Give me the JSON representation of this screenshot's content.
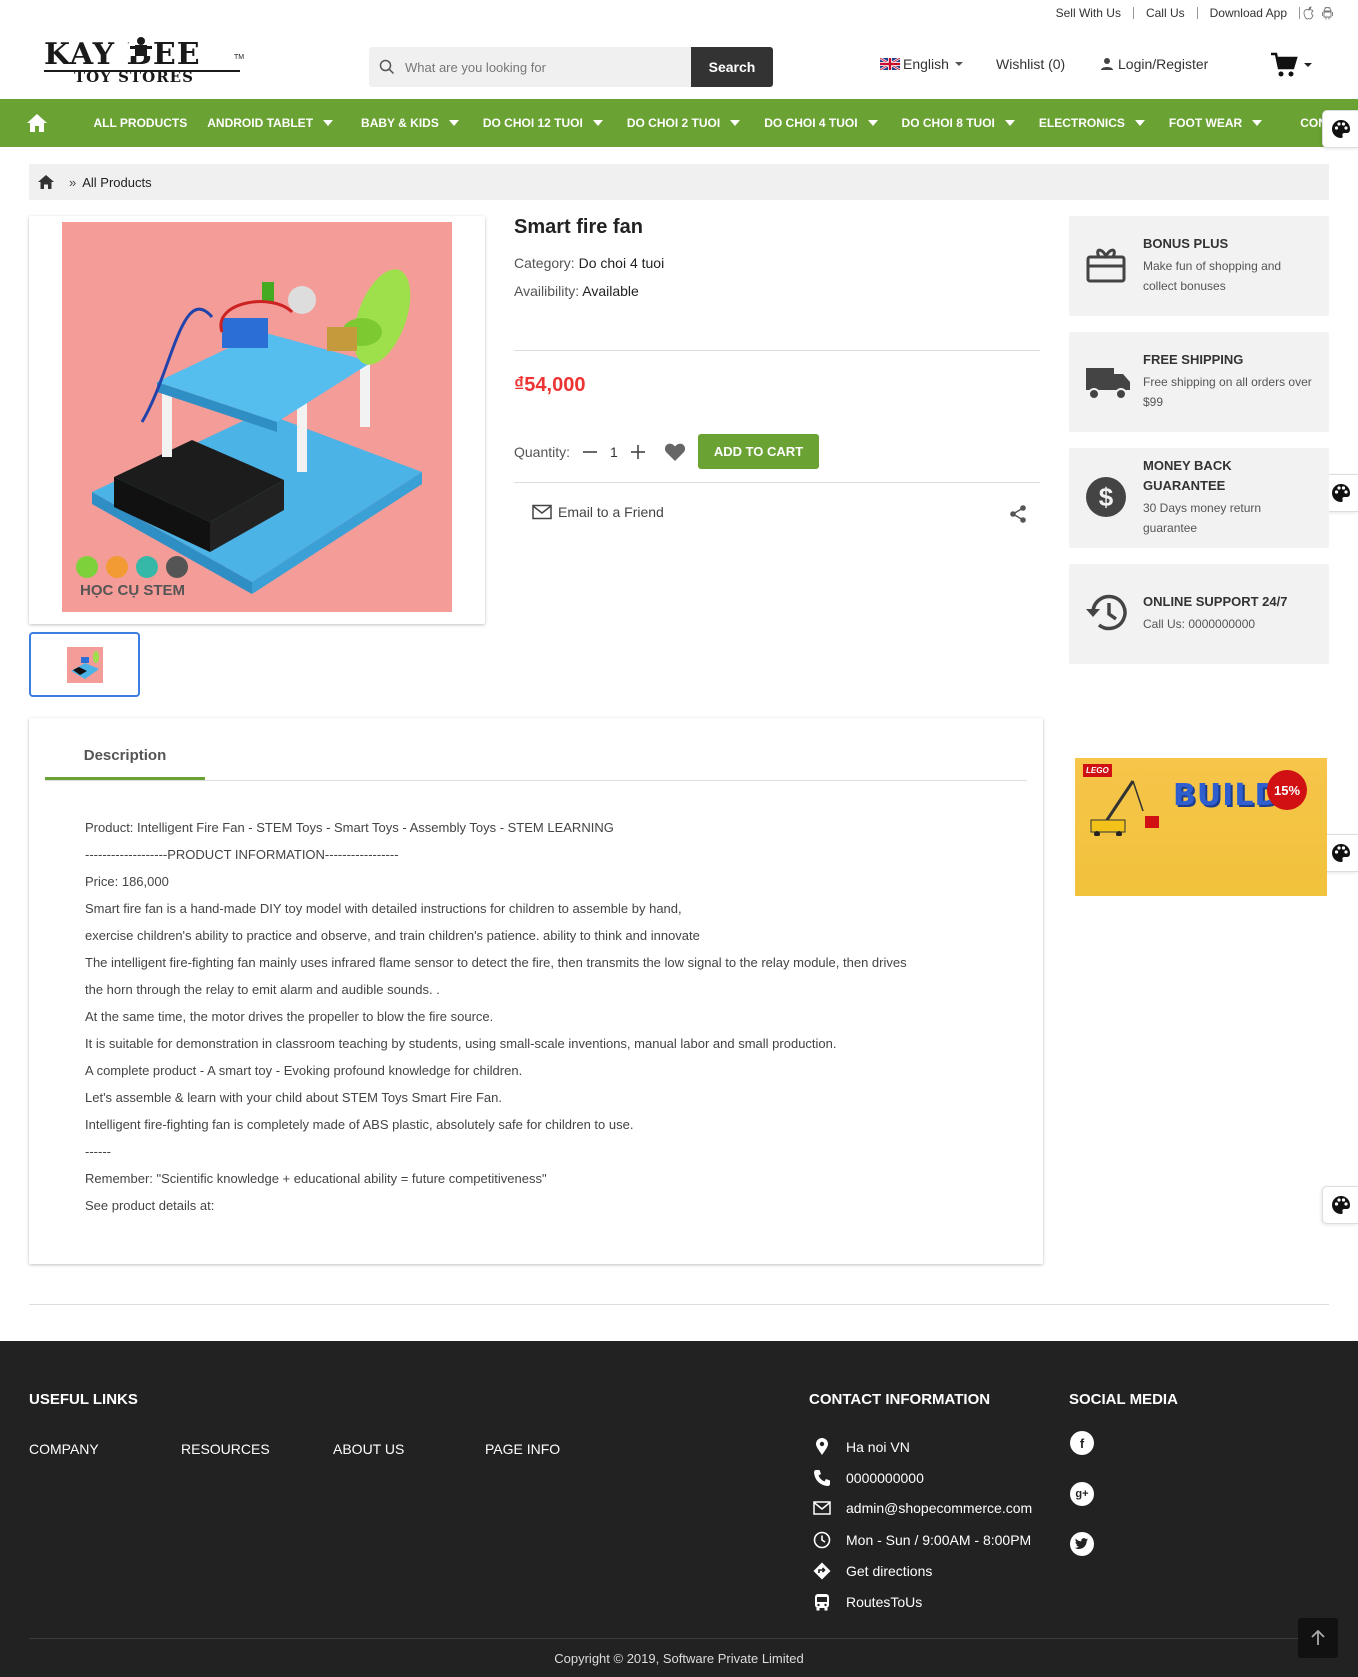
{
  "topbar": {
    "sell": "Sell With Us",
    "call": "Call Us",
    "download": "Download App"
  },
  "logo": {
    "line1": "KAY BEE",
    "line2": "TOY STORES",
    "tm": "TM"
  },
  "search": {
    "placeholder": "What are you looking for",
    "button": "Search"
  },
  "header": {
    "language": "English",
    "wishlist": "Wishlist (0)",
    "login": "Login/Register"
  },
  "nav": {
    "items": [
      {
        "label": "ALL PRODUCTS"
      },
      {
        "label": "ANDROID TABLET"
      },
      {
        "label": "BABY & KIDS"
      },
      {
        "label": "DO CHOI 12 TUOI"
      },
      {
        "label": "DO CHOI 2 TUOI"
      },
      {
        "label": "DO CHOI 4 TUOI"
      },
      {
        "label": "DO CHOI 8 TUOI"
      },
      {
        "label": "ELECTRONICS"
      },
      {
        "label": "FOOT WEAR"
      },
      {
        "label": "CONTACT"
      }
    ]
  },
  "breadcrumb": {
    "current": "All Products"
  },
  "product": {
    "title": "Smart fire fan",
    "category_label": "Category:",
    "category": "Do choi 4 tuoi",
    "availability_label": "Availibility:",
    "availability": "Available",
    "price": "₫54,000",
    "quantity_label": "Quantity:",
    "quantity": "1",
    "add_to_cart": "ADD TO CART",
    "email_friend": "Email to a Friend",
    "image_watermark": "HỌC CỤ STEM"
  },
  "services": [
    {
      "title": "BONUS PLUS",
      "sub": "Make fun of shopping and collect bonuses"
    },
    {
      "title": "FREE SHIPPING",
      "sub": "Free shipping on all orders over $99"
    },
    {
      "title": "MONEY BACK GUARANTEE",
      "sub": "30 Days money return guarantee"
    },
    {
      "title": "ONLINE SUPPORT 24/7",
      "sub": "Call Us: 0000000000"
    }
  ],
  "description": {
    "tab": "Description",
    "lines": [
      "Product: Intelligent Fire Fan - STEM Toys - Smart Toys - Assembly Toys - STEM LEARNING",
      "-------------------PRODUCT INFORMATION-----------------",
      "Price: 186,000",
      "Smart fire fan is a hand-made DIY toy model with detailed instructions for children to assemble by hand,",
      "exercise children's ability to practice and observe, and train children's patience. ability to think and innovate",
      "The intelligent fire-fighting fan mainly uses infrared flame sensor to detect the fire, then transmits the low signal to the relay module, then drives",
      "the horn through the relay to emit alarm and audible sounds. .",
      "At the same time, the motor drives the propeller to blow the fire source.",
      "It is suitable for demonstration in classroom teaching by students, using small-scale inventions, manual labor and small production.",
      "A complete product - A smart toy - Evoking profound knowledge for children.",
      "Let's assemble & learn with your child about STEM Toys Smart Fire Fan.",
      "Intelligent fire-fighting fan is completely made of ABS plastic, absolutely safe for children to use.",
      "------",
      "Remember: \"Scientific knowledge + educational ability = future competitiveness\"",
      "See product details at:"
    ]
  },
  "banner": {
    "brand": "LEGO",
    "word": "BUILD",
    "badge": "15%"
  },
  "footer": {
    "useful_links_title": "USEFUL LINKS",
    "links": [
      "COMPANY",
      "RESOURCES",
      "ABOUT US",
      "PAGE INFO"
    ],
    "contact_title": "CONTACT INFORMATION",
    "address": "Ha noi VN",
    "phone": "0000000000",
    "email": "admin@shopecommerce.com",
    "hours": "Mon - Sun / 9:00AM - 8:00PM",
    "directions": "Get directions",
    "routes": "RoutesToUs",
    "social_title": "SOCIAL MEDIA",
    "copyright": "Copyright © 2019, Software Private Limited"
  },
  "colors": {
    "accent": "#6aa233",
    "price": "#e33333",
    "footer_bg": "#222222"
  }
}
